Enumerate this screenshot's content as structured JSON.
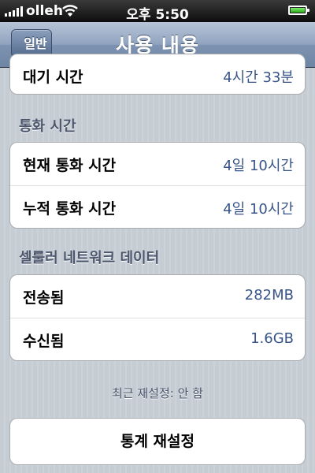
{
  "status_bar": {
    "carrier": "olleh",
    "time": "오후 5:50",
    "signal_icon": "signal-bars-icon",
    "wifi_icon": "wifi-icon",
    "battery_icon": "battery-icon",
    "battery_level": 1.0
  },
  "nav": {
    "back_label": "일반",
    "title": "사용 내용"
  },
  "standby_group": {
    "rows": [
      {
        "label": "대기 시간",
        "value": "4시간 33분"
      }
    ]
  },
  "call_time": {
    "header": "통화 시간",
    "rows": [
      {
        "label": "현재 통화 시간",
        "value": "4일 10시간"
      },
      {
        "label": "누적 통화 시간",
        "value": "4일 10시간"
      }
    ]
  },
  "cellular": {
    "header": "셀룰러 네트워크 데이터",
    "rows": [
      {
        "label": "전송됨",
        "value": "282MB"
      },
      {
        "label": "수신됨",
        "value": "1.6GB"
      }
    ]
  },
  "footer": {
    "last_reset": "최근 재설정: 안 함",
    "reset_button": "통계 재설정"
  }
}
